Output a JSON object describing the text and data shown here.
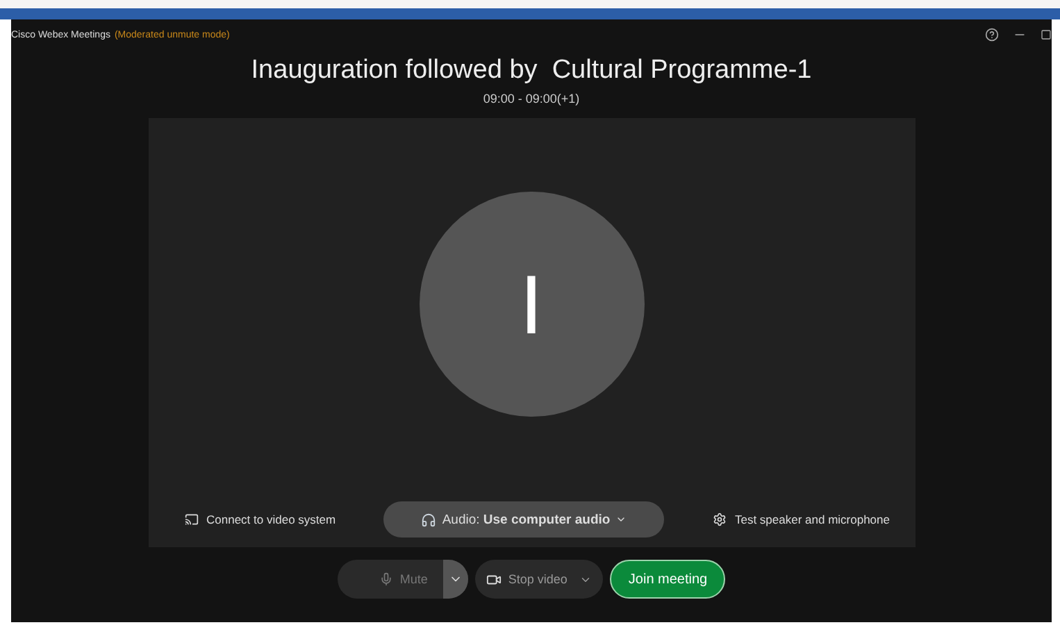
{
  "window": {
    "title": "Cisco Webex Meetings",
    "mode": "(Moderated unmute mode)"
  },
  "meeting": {
    "title": "Inauguration followed by  Cultural Programme-1",
    "time": "09:00 - 09:00(+1)"
  },
  "avatar": {
    "initial": "I"
  },
  "options": {
    "video_system": "Connect to video system",
    "audio": "Audio: **Use computer audio**",
    "test": "Test speaker and microphone"
  },
  "controls": [
    {
      "kind": "mute",
      "label": "Mute",
      "disabled": true
    },
    {
      "kind": "video",
      "label": "Stop video"
    },
    {
      "kind": "join",
      "label": "Join meeting"
    }
  ]
}
